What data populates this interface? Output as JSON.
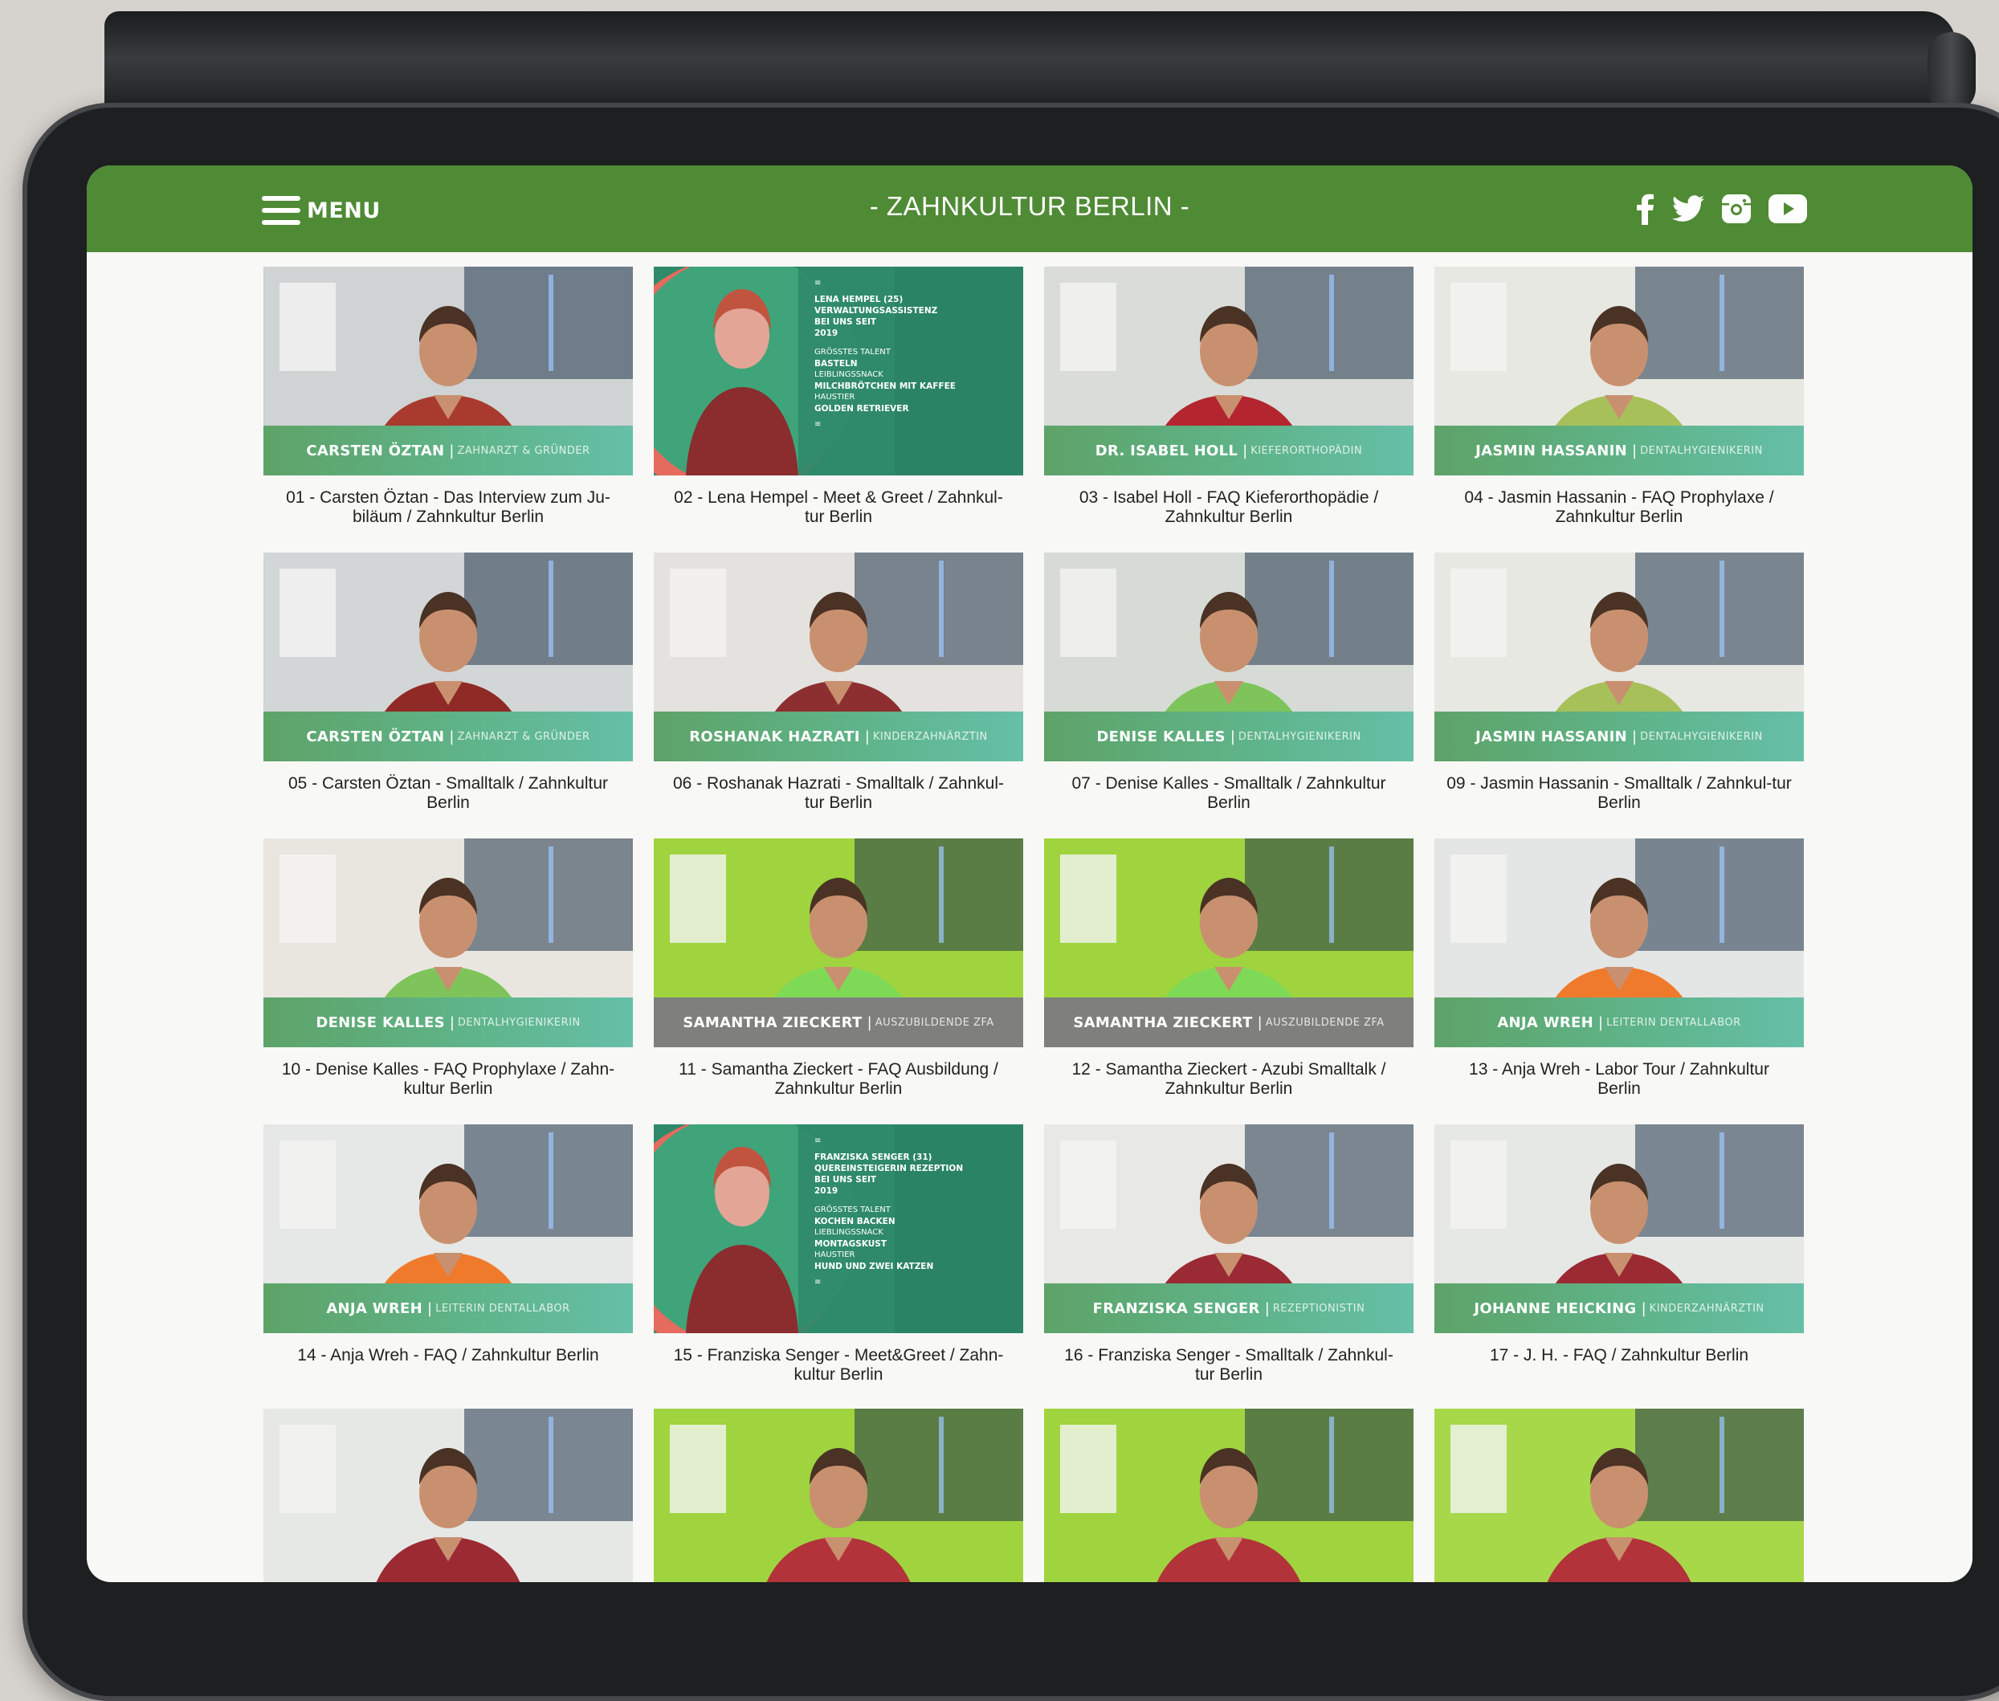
{
  "nav": {
    "menu_label": "MENU",
    "site_title": "- ZAHNKULTUR BERLIN -",
    "social": [
      "facebook-icon",
      "twitter-icon",
      "instagram-icon",
      "youtube-icon"
    ]
  },
  "colors": {
    "brand_green": "#4f8a35",
    "bar_green": "#5fb58c",
    "bar_gray": "#7f807e"
  },
  "videos": [
    {
      "name": "CARSTEN ÖZTAN",
      "role": "ZAHNARZT & GRÜNDER",
      "caption": "01 - Carsten Öztan - Das Interview zum Ju-biläum / Zahnkultur Berlin",
      "bar": "green",
      "scrub": "#a83b2e",
      "bg": "#cfd3d4"
    },
    {
      "name": "",
      "role": "",
      "caption": "02 - Lena Hempel - Meet & Greet / Zahnkul-tur Berlin",
      "bar": "none",
      "promo": {
        "line1": "LENA HEMPEL (25)",
        "line2": "VERWALTUNGSASSISTENZ",
        "line3": "BEI UNS SEIT",
        "year": "2019",
        "k1": "GRÖSSTES TALENT",
        "v1": "BASTELN",
        "k2": "LEIBLINGSSNACK",
        "v2": "MILCHBRÖTCHEN MIT KAFFEE",
        "k3": "HAUSTIER",
        "v3": "GOLDEN RETRIEVER"
      }
    },
    {
      "name": "DR. ISABEL HOLL",
      "role": "KIEFERORTHOPÄDIN",
      "caption": "03 - Isabel Holl - FAQ Kieferorthopädie / Zahnkultur Berlin",
      "bar": "green",
      "scrub": "#b3262f",
      "bg": "#d9dcd8"
    },
    {
      "name": "JASMIN HASSANIN",
      "role": "DENTALHYGIENIKERIN",
      "caption": "04 - Jasmin Hassanin - FAQ Prophylaxe / Zahnkultur Berlin",
      "bar": "green",
      "scrub": "#a7c05a",
      "bg": "#e7e8e2"
    },
    {
      "name": "CARSTEN ÖZTAN",
      "role": "ZAHNARZT & GRÜNDER",
      "caption": "05 - Carsten Öztan - Smalltalk / Zahnkultur Berlin",
      "bar": "green",
      "scrub": "#8f2a27",
      "bg": "#d3d6d6"
    },
    {
      "name": "ROSHANAK HAZRATI",
      "role": "KINDERZAHNÄRZTIN",
      "caption": "06 - Roshanak Hazrati - Smalltalk / Zahnkul-tur Berlin",
      "bar": "green",
      "scrub": "#8d2f31",
      "bg": "#e4e2de"
    },
    {
      "name": "DENISE KALLES",
      "role": "DENTALHYGIENIKERIN",
      "caption": "07 - Denise Kalles - Smalltalk / Zahnkultur Berlin",
      "bar": "green",
      "scrub": "#7ec45a",
      "bg": "#d7dbd6"
    },
    {
      "name": "JASMIN HASSANIN",
      "role": "DENTALHYGIENIKERIN",
      "caption": "09 - Jasmin Hassanin - Smalltalk / Zahnkul-tur Berlin",
      "bar": "green",
      "scrub": "#a7c05a",
      "bg": "#e7e8e2"
    },
    {
      "name": "DENISE KALLES",
      "role": "DENTALHYGIENIKERIN",
      "caption": "10 - Denise Kalles - FAQ Prophylaxe / Zahn-kultur Berlin",
      "bar": "green",
      "scrub": "#7ec45a",
      "bg": "#e9e6e0"
    },
    {
      "name": "SAMANTHA ZIECKERT",
      "role": "AUSZUBILDENDE ZFA",
      "caption": "11 - Samantha Zieckert - FAQ Ausbildung / Zahnkultur Berlin",
      "bar": "gray",
      "scrub": "#7ed957",
      "bg": "#9fd43f"
    },
    {
      "name": "SAMANTHA ZIECKERT",
      "role": "AUSZUBILDENDE ZFA",
      "caption": "12 - Samantha Zieckert - Azubi Smalltalk / Zahnkultur Berlin",
      "bar": "gray",
      "scrub": "#7ed957",
      "bg": "#9fd43f"
    },
    {
      "name": "ANJA WREH",
      "role": "LEITERIN DENTALLABOR",
      "caption": "13 - Anja Wreh - Labor Tour / Zahnkultur Berlin",
      "bar": "green",
      "scrub": "#f07a2c",
      "bg": "#e3e6e4"
    },
    {
      "name": "ANJA WREH",
      "role": "LEITERIN DENTALLABOR",
      "caption": "14 - Anja Wreh - FAQ / Zahnkultur Berlin",
      "bar": "green",
      "scrub": "#f07a2c",
      "bg": "#e5e8e6"
    },
    {
      "name": "",
      "role": "",
      "caption": "15 - Franziska Senger - Meet&Greet / Zahn-kultur Berlin",
      "bar": "none",
      "promo": {
        "line1": "FRANZISKA SENGER (31)",
        "line2": "QUEREINSTEIGERIN REZEPTION",
        "line3": "BEI UNS SEIT",
        "year": "2019",
        "k1": "GRÖSSTES TALENT",
        "v1": "KOCHEN BACKEN",
        "k2": "LIEBLINGSSNACK",
        "v2": "MONTAGSKUST",
        "k3": "HAUSTIER",
        "v3": "HUND UND ZWEI KATZEN"
      }
    },
    {
      "name": "FRANZISKA SENGER",
      "role": "REZEPTIONISTIN",
      "caption": "16 - Franziska Senger - Smalltalk / Zahnkul-tur Berlin",
      "bar": "green",
      "scrub": "#9a2a34",
      "bg": "#e8e9e6"
    },
    {
      "name": "JOHANNE HEICKING",
      "role": "KINDERZAHNÄRZTIN",
      "caption": "17 - J. H. - FAQ / Zahnkultur Berlin",
      "bar": "green",
      "scrub": "#9c2a33",
      "bg": "#e6e8e6"
    }
  ],
  "partial_row": [
    {
      "scrub": "#9c2a33",
      "bg": "#e6e8e6"
    },
    {
      "scrub": "#b2333a",
      "bg": "#9fd43f"
    },
    {
      "scrub": "#b2333a",
      "bg": "#9fd43f"
    },
    {
      "scrub": "#b2333a",
      "bg": "#a7d84a"
    }
  ]
}
